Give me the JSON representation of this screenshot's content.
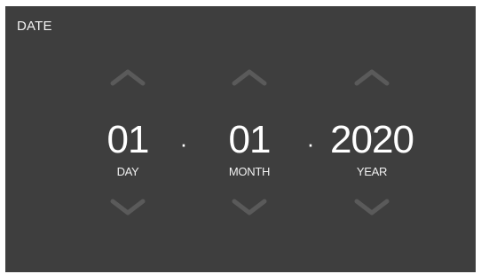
{
  "title": "DATE",
  "separator": "·",
  "colors": {
    "background": "#3e3e3e",
    "text": "#ffffff",
    "arrow": "#5a5a5a"
  },
  "fields": {
    "day": {
      "value": "01",
      "label": "DAY"
    },
    "month": {
      "value": "01",
      "label": "MONTH"
    },
    "year": {
      "value": "2020",
      "label": "YEAR"
    }
  },
  "icons": {
    "up": "chevron-up-icon",
    "down": "chevron-down-icon"
  }
}
